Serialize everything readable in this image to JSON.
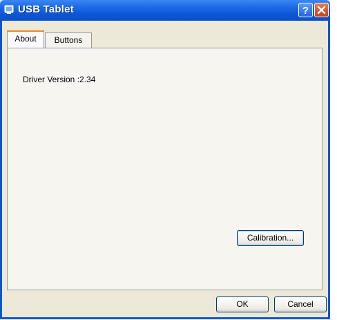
{
  "window": {
    "title": "USB Tablet"
  },
  "title_buttons": {
    "help_glyph": "?",
    "close_icon": "close-icon"
  },
  "tabs": [
    {
      "label": "About",
      "selected": true
    },
    {
      "label": "Buttons",
      "selected": false
    }
  ],
  "about": {
    "driver_version": "Driver Version :2.34",
    "calibration_label": "Calibration..."
  },
  "footer": {
    "ok_label": "OK",
    "cancel_label": "Cancel"
  },
  "colors": {
    "titlebar": "#0a55d6",
    "dialog_bg": "#ece9d8",
    "close_button": "#c8401c",
    "tab_highlight": "#e68b2c"
  }
}
